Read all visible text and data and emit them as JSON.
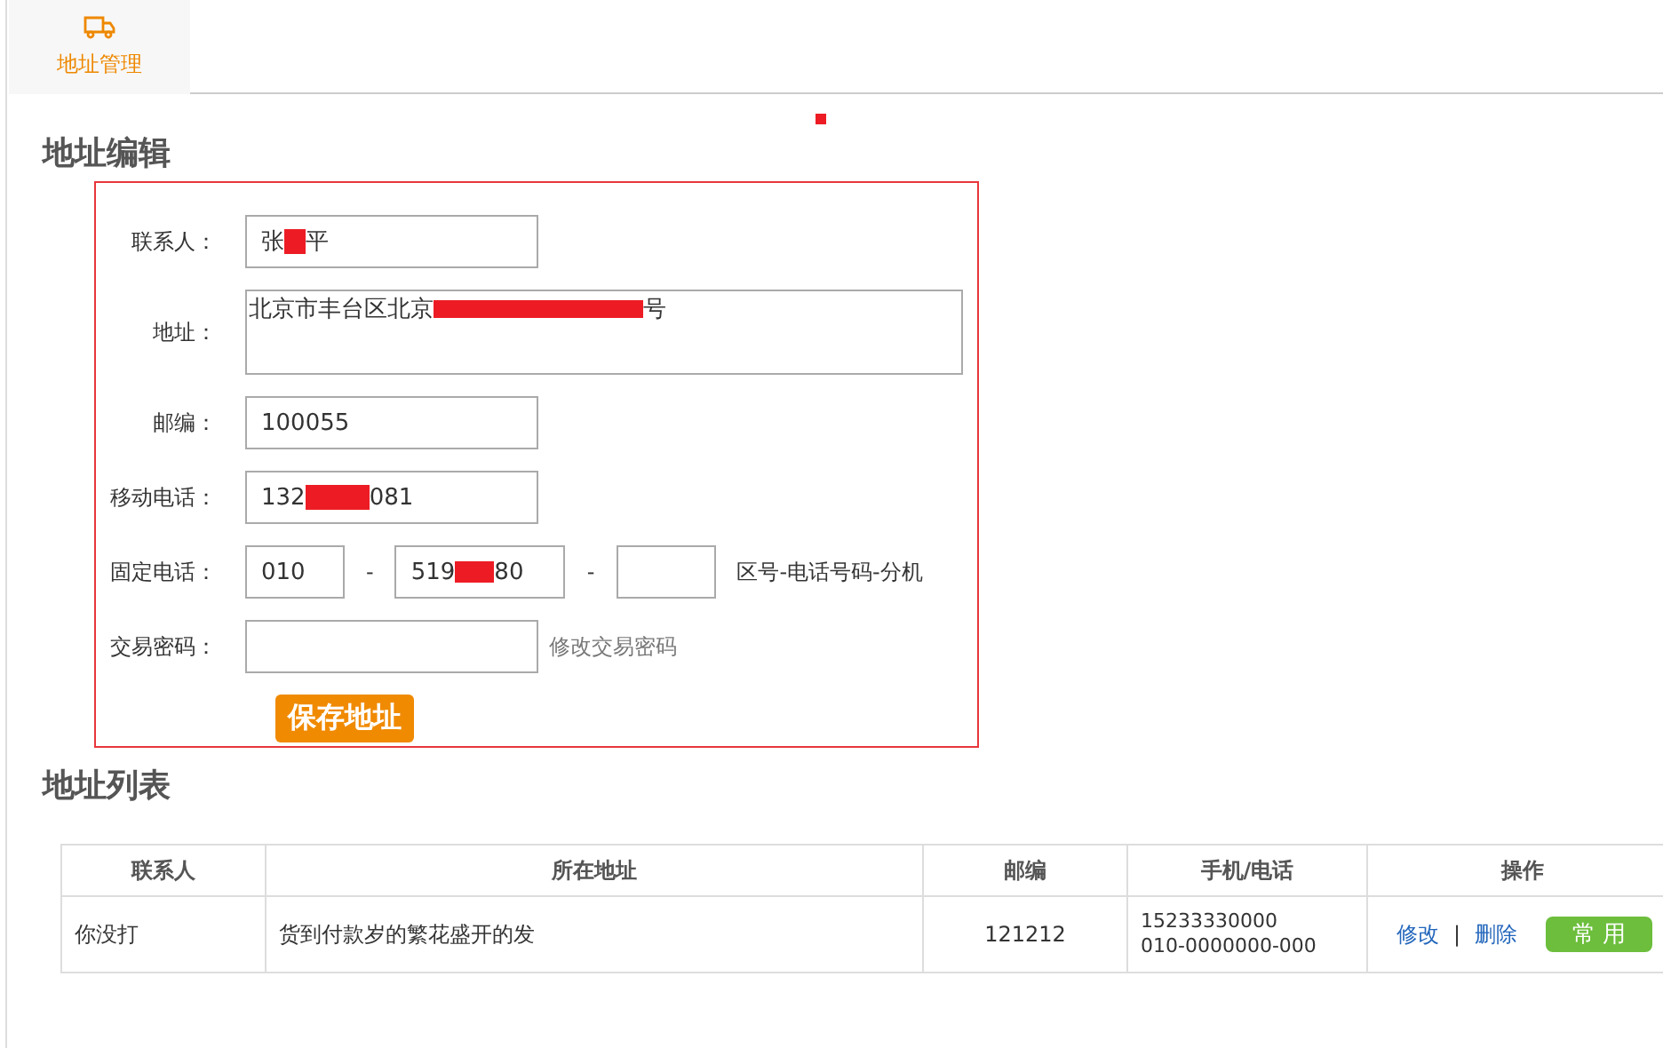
{
  "tabs": [
    {
      "label": "地址管理",
      "selected": true
    }
  ],
  "edit_section": {
    "title": "地址编辑",
    "fields": [
      {
        "kind": "redacted",
        "label": "联系人：",
        "before": "张",
        "after": "平"
      },
      {
        "kind": "textarea",
        "label": "地址：",
        "before": "北京市丰台区北京",
        "after": "号"
      },
      {
        "kind": "text",
        "label": "邮编：",
        "value": "100055"
      },
      {
        "kind": "redacted",
        "label": "移动电话：",
        "before": "132",
        "after": "081"
      },
      {
        "kind": "phone",
        "label": "固定电话：",
        "area": "010",
        "before": "519",
        "after": "80",
        "separator": "-",
        "hint": "区号-电话号码-分机"
      },
      {
        "kind": "password",
        "label": "交易密码：",
        "link": "修改交易密码"
      }
    ],
    "save_button": "保存地址"
  },
  "list_section": {
    "title": "地址列表",
    "columns": [
      "联系人",
      "所在地址",
      "邮编",
      "手机/电话",
      "操作"
    ],
    "rows": [
      {
        "contact": "你没打",
        "address": "货到付款岁的繁花盛开的发",
        "zip": "121212",
        "phones": [
          "15233330000",
          "010-0000000-000"
        ],
        "edit": "修改",
        "divider": "|",
        "delete": "删除",
        "default": "常 用"
      }
    ]
  }
}
